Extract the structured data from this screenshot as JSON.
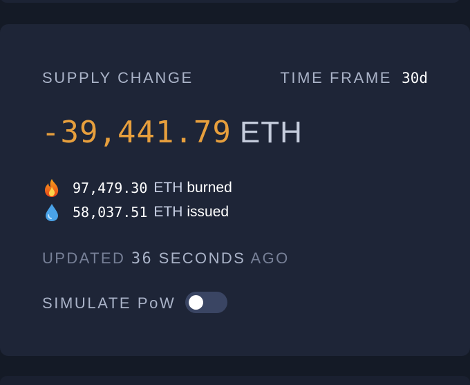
{
  "supply": {
    "label": "SUPPLY CHANGE",
    "time_frame_label": "TIME FRAME",
    "time_frame_value": "30d",
    "amount": "-39,441.79",
    "unit": "ETH"
  },
  "stats": {
    "burned": {
      "icon": "fire-icon",
      "value": "97,479.30",
      "unit": "ETH",
      "word": "burned"
    },
    "issued": {
      "icon": "droplet-icon",
      "value": "58,037.51",
      "unit": "ETH",
      "word": "issued"
    }
  },
  "updated": {
    "prefix": "UPDATED",
    "number": "36",
    "unit": "SECONDS",
    "suffix": "AGO"
  },
  "simulate": {
    "label": "SIMULATE PoW",
    "enabled": false
  },
  "colors": {
    "background": "#141a26",
    "card": "#1e2537",
    "amount": "#e79f3d",
    "label": "#aab3c8",
    "toggle_track": "#3a4563"
  }
}
